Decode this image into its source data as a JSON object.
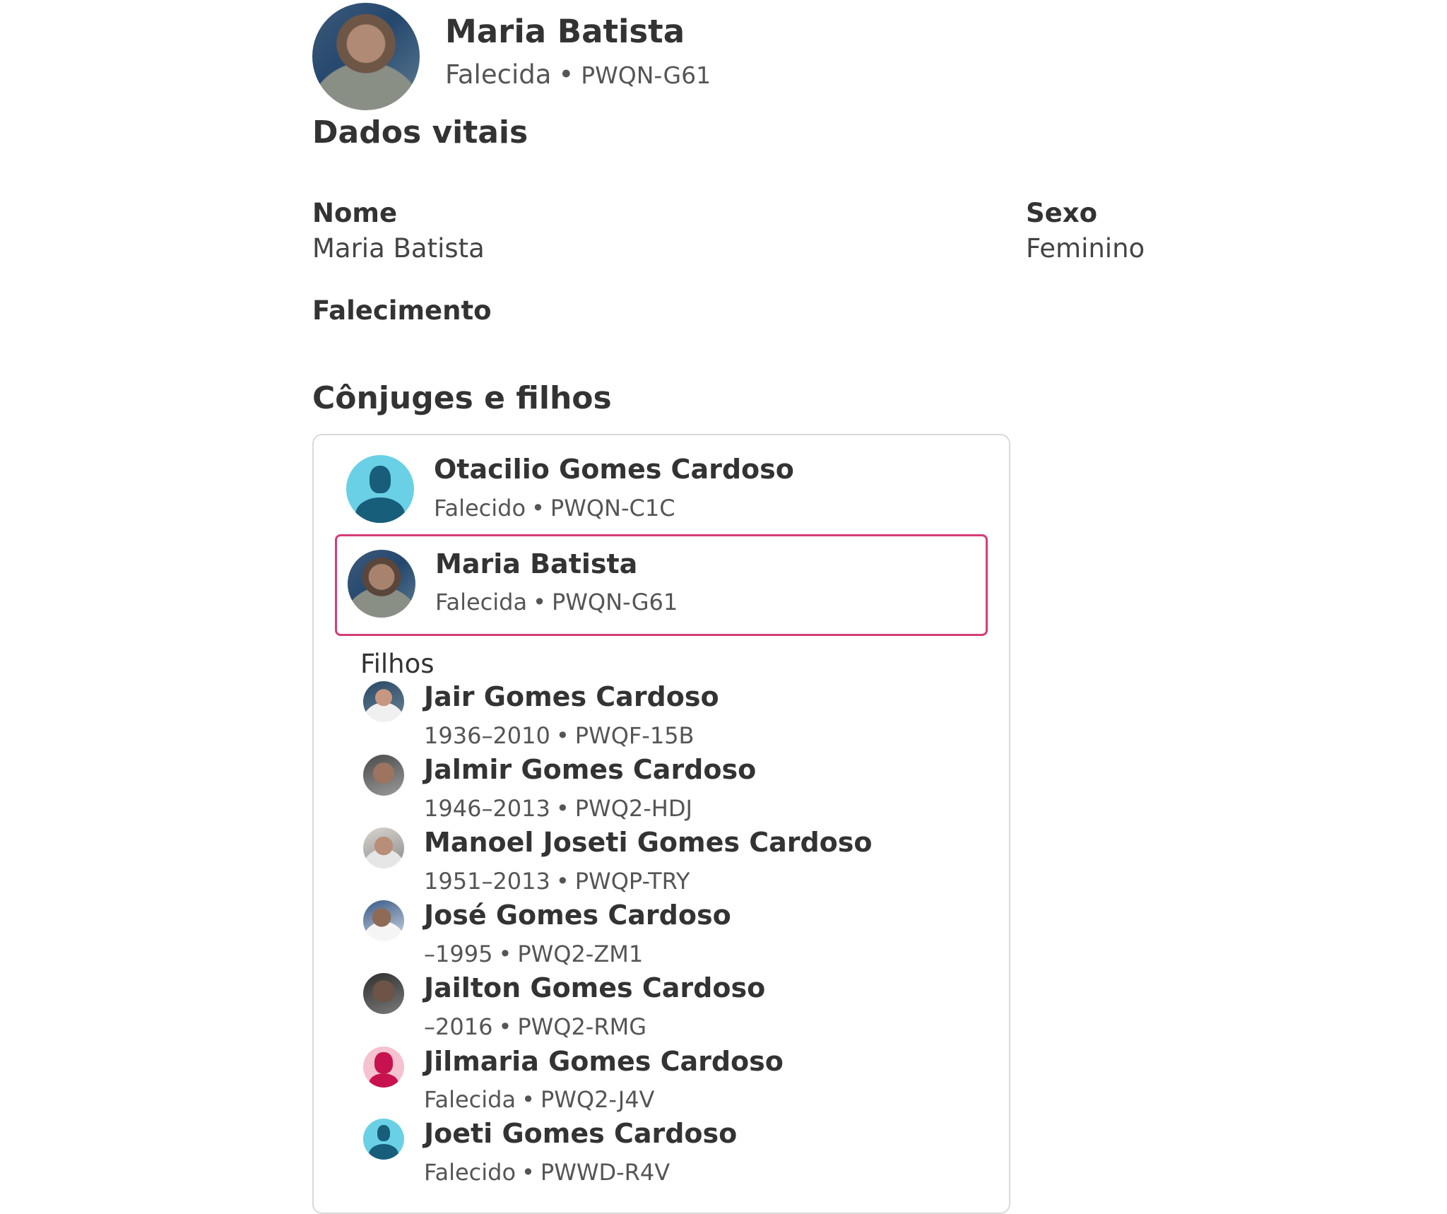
{
  "header": {
    "name": "Maria Batista",
    "status": "Falecida",
    "separator": "•",
    "pid": "PWQN-G61"
  },
  "vitals": {
    "title": "Dados vitais",
    "name_label": "Nome",
    "name_value": "Maria Batista",
    "sex_label": "Sexo",
    "sex_value": "Feminino",
    "death_label": "Falecimento"
  },
  "family": {
    "title": "Cônjuges e filhos",
    "spouse": {
      "name": "Otacilio Gomes Cardoso",
      "status": "Falecido",
      "pid": "PWQN-C1C",
      "avatar": "male-silhouette-icon"
    },
    "self": {
      "name": "Maria Batista",
      "status": "Falecida",
      "pid": "PWQN-G61",
      "avatar": "photo"
    },
    "children_label": "Filhos",
    "children": [
      {
        "name": "Jair Gomes Cardoso",
        "sub": "1936–2010",
        "pid": "PWQF-15B",
        "avatar": "photo"
      },
      {
        "name": "Jalmir Gomes Cardoso",
        "sub": "1946–2013",
        "pid": "PWQ2-HDJ",
        "avatar": "photo"
      },
      {
        "name": "Manoel Joseti Gomes Cardoso",
        "sub": "1951–2013",
        "pid": "PWQP-TRY",
        "avatar": "photo"
      },
      {
        "name": "José Gomes Cardoso",
        "sub": "–1995",
        "pid": "PWQ2-ZM1",
        "avatar": "photo"
      },
      {
        "name": "Jailton Gomes Cardoso",
        "sub": "–2016",
        "pid": "PWQ2-RMG",
        "avatar": "photo"
      },
      {
        "name": "Jilmaria Gomes Cardoso",
        "sub": "Falecida",
        "pid": "PWQ2-J4V",
        "avatar": "female-silhouette-icon"
      },
      {
        "name": "Joeti Gomes Cardoso",
        "sub": "Falecido",
        "pid": "PWWD-R4V",
        "avatar": "male-silhouette-icon"
      }
    ]
  },
  "colors": {
    "selected_border": "#d63d78",
    "male_avatar_bg": "#6ad0e6",
    "male_avatar_fg": "#175e7a",
    "female_avatar_bg": "#f6c2cf",
    "female_avatar_fg": "#c8124f"
  }
}
